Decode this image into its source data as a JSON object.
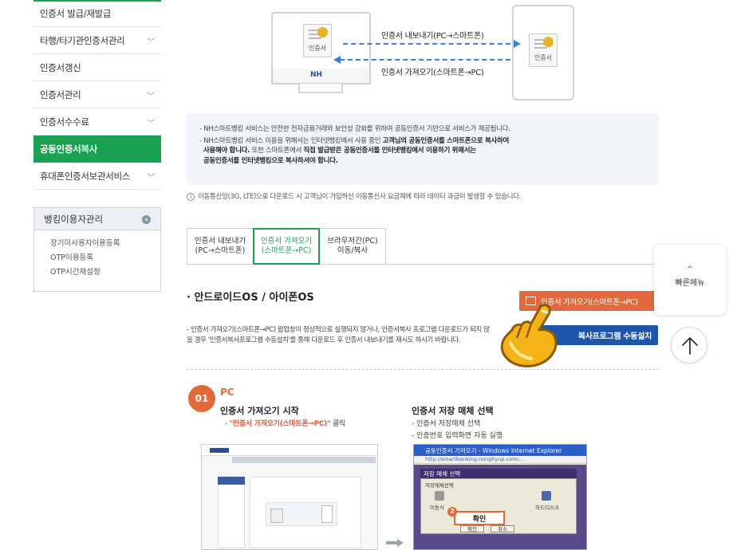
{
  "sidebar": {
    "items": [
      {
        "label": "인증서 발급/재발급",
        "chevron": false
      },
      {
        "label": "타행/타기관인증서관리",
        "chevron": true
      },
      {
        "label": "인증서갱신",
        "chevron": false
      },
      {
        "label": "인증서관리",
        "chevron": true
      },
      {
        "label": "인증서수수료",
        "chevron": true
      },
      {
        "label": "공동인증서복사",
        "chevron": false,
        "active": true
      },
      {
        "label": "휴대폰인증서보관서비스",
        "chevron": true
      }
    ],
    "box": {
      "title": "뱅킹이용자관리",
      "links": [
        "장기미사용자이용등록",
        "OTP이용등록",
        "OTP시간재설정"
      ]
    }
  },
  "diagram": {
    "pc_cert_label": "인증서",
    "phone_cert_label": "인증서",
    "pc_brand": "NH",
    "export_label": "인증서 내보내기(PC→스마트폰)",
    "import_label": "인증서 가져오기(스마트폰→PC)"
  },
  "notice": {
    "line1": "- NH스마트뱅킹 서비스는 안전한 전자금융거래와 보안성 강화를 위하여 공동인증서 기반으로 서비스가 제공됩니다.",
    "line2a": "- NH스마트뱅킹 서비스 이용을 위해서는 인터넷뱅킹에서 사용 중인 ",
    "line2b": "고객님의 공동인증서를 스마트폰으로 복사하여",
    "line2c": "사용해야 합니다.",
    "line2d": " 또한 스마트폰에서 ",
    "line2e": "직접 발급받은 공동인증서를 인터넷뱅킹에서 이용하기 위해서는",
    "line2f": "공동인증서를 인터넷뱅킹으로 복사하셔야 합니다."
  },
  "info": "이동통신망(3G, LTE)으로 다운로드 시 고객님이 가입하신 이동통신사 요금제에 따라 데이터 과금이 발생할 수 있습니다.",
  "tabs": [
    {
      "line1": "인증서 내보내기",
      "line2": "(PC→스마트폰)"
    },
    {
      "line1": "인증서 가져오기",
      "line2": "(스마트폰→PC)"
    },
    {
      "line1": "브라우저간(PC)",
      "line2": "이동/복사"
    }
  ],
  "section": {
    "title": "· 안드로이드OS / 아이폰OS",
    "export_button": "인증서 가져오기(스마트폰→PC)",
    "manual_button": "복사프로그램 수동설치",
    "desc": "- 인증서 가져오기(스마트폰→PC) 팝업창이 정상적으로 실행되지 않거나, 인증서복사 프로그램 다운로드가 되지 않을 경우 '인증서복사프로그램 수동설치'를 통해 다운로드 후 인증서 내보내기를 재시도 하시기 바랍니다."
  },
  "step": {
    "number": "01",
    "platform": "PC",
    "s1_title": "인증서 가져오기 시작",
    "s1_prefix": "- ",
    "s1_highlight": "\"인증서 가져오기(스마트폰→PC)\"",
    "s1_suffix": " 클릭",
    "s2_title": "인증서 저장 매체 선택",
    "s2_line1": "- 인증서 저장매체 선택",
    "s2_line2": "- 인증번호 입력화면 자동 실행"
  },
  "screenshot2": {
    "window_title": "공동인증서 가져오기 - Windows Internet Explorer",
    "url": "http://smartbanking.nonghyup.com/...",
    "dialog_title": "저장 매체 선택",
    "group_label": "저장매체선택",
    "options": [
      "이동식",
      "",
      "",
      "하드디스크"
    ],
    "callout": "확인",
    "ok": "확인",
    "cancel": "취소",
    "badge": "2"
  },
  "floating": {
    "quick_menu": "빠른메뉴",
    "quick_up": "^",
    "top_arrow": "↑"
  },
  "colors": {
    "green": "#1aa152",
    "orange": "#e06a3b",
    "blue": "#1e56a8",
    "arrow_blue": "#3d7fd8"
  }
}
